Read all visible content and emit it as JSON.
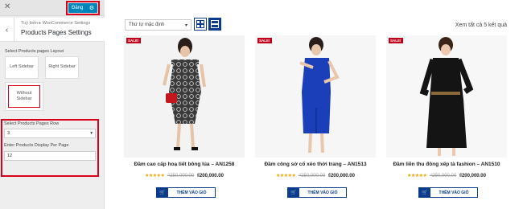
{
  "customizer": {
    "publish_label": "Đăng",
    "breadcrumb": "Tuỳ biến ▸ WooCommerce Settings",
    "section_title": "Products Pages Settings",
    "layout_label": "Select Products pages Layout",
    "layouts": [
      {
        "label": "Left Sidebar",
        "selected": false
      },
      {
        "label": "Right Sidebar",
        "selected": false
      },
      {
        "label": "Without Sidebar",
        "selected": true
      }
    ],
    "row_label": "Select Products Pages Row",
    "row_value": "3",
    "per_page_label": "Enter Products Display Per Page",
    "per_page_value": "12"
  },
  "store": {
    "sort_value": "Thứ tự mặc định",
    "result_count": "Xem tất cả 5 kết quả",
    "products": [
      {
        "badge": "SALE!",
        "name": "Đầm cao cấp hoạ tiết bông lúa – AN1258",
        "old_price": "₫250,000.00",
        "price": "₫200,000.00",
        "button": "THÊM VÀO GIỎ",
        "rating": 5
      },
      {
        "badge": "SALE!",
        "name": "Đầm công sở cổ xéo thời trang – AN1513",
        "old_price": "₫250,000.00",
        "price": "₫200,000.00",
        "button": "THÊM VÀO GIỎ",
        "rating": 5
      },
      {
        "badge": "SALE!",
        "name": "Đầm liền thu đông xếp tà fashion – AN1510",
        "old_price": "₫250,000.00",
        "price": "₫200,000.00",
        "button": "THÊM VÀO GIỎ",
        "rating": 5
      }
    ]
  },
  "colors": {
    "accent_blue": "#0b3b8c",
    "highlight_red": "#d9001b",
    "sale_red": "#c0001a",
    "star": "#f0a500"
  }
}
